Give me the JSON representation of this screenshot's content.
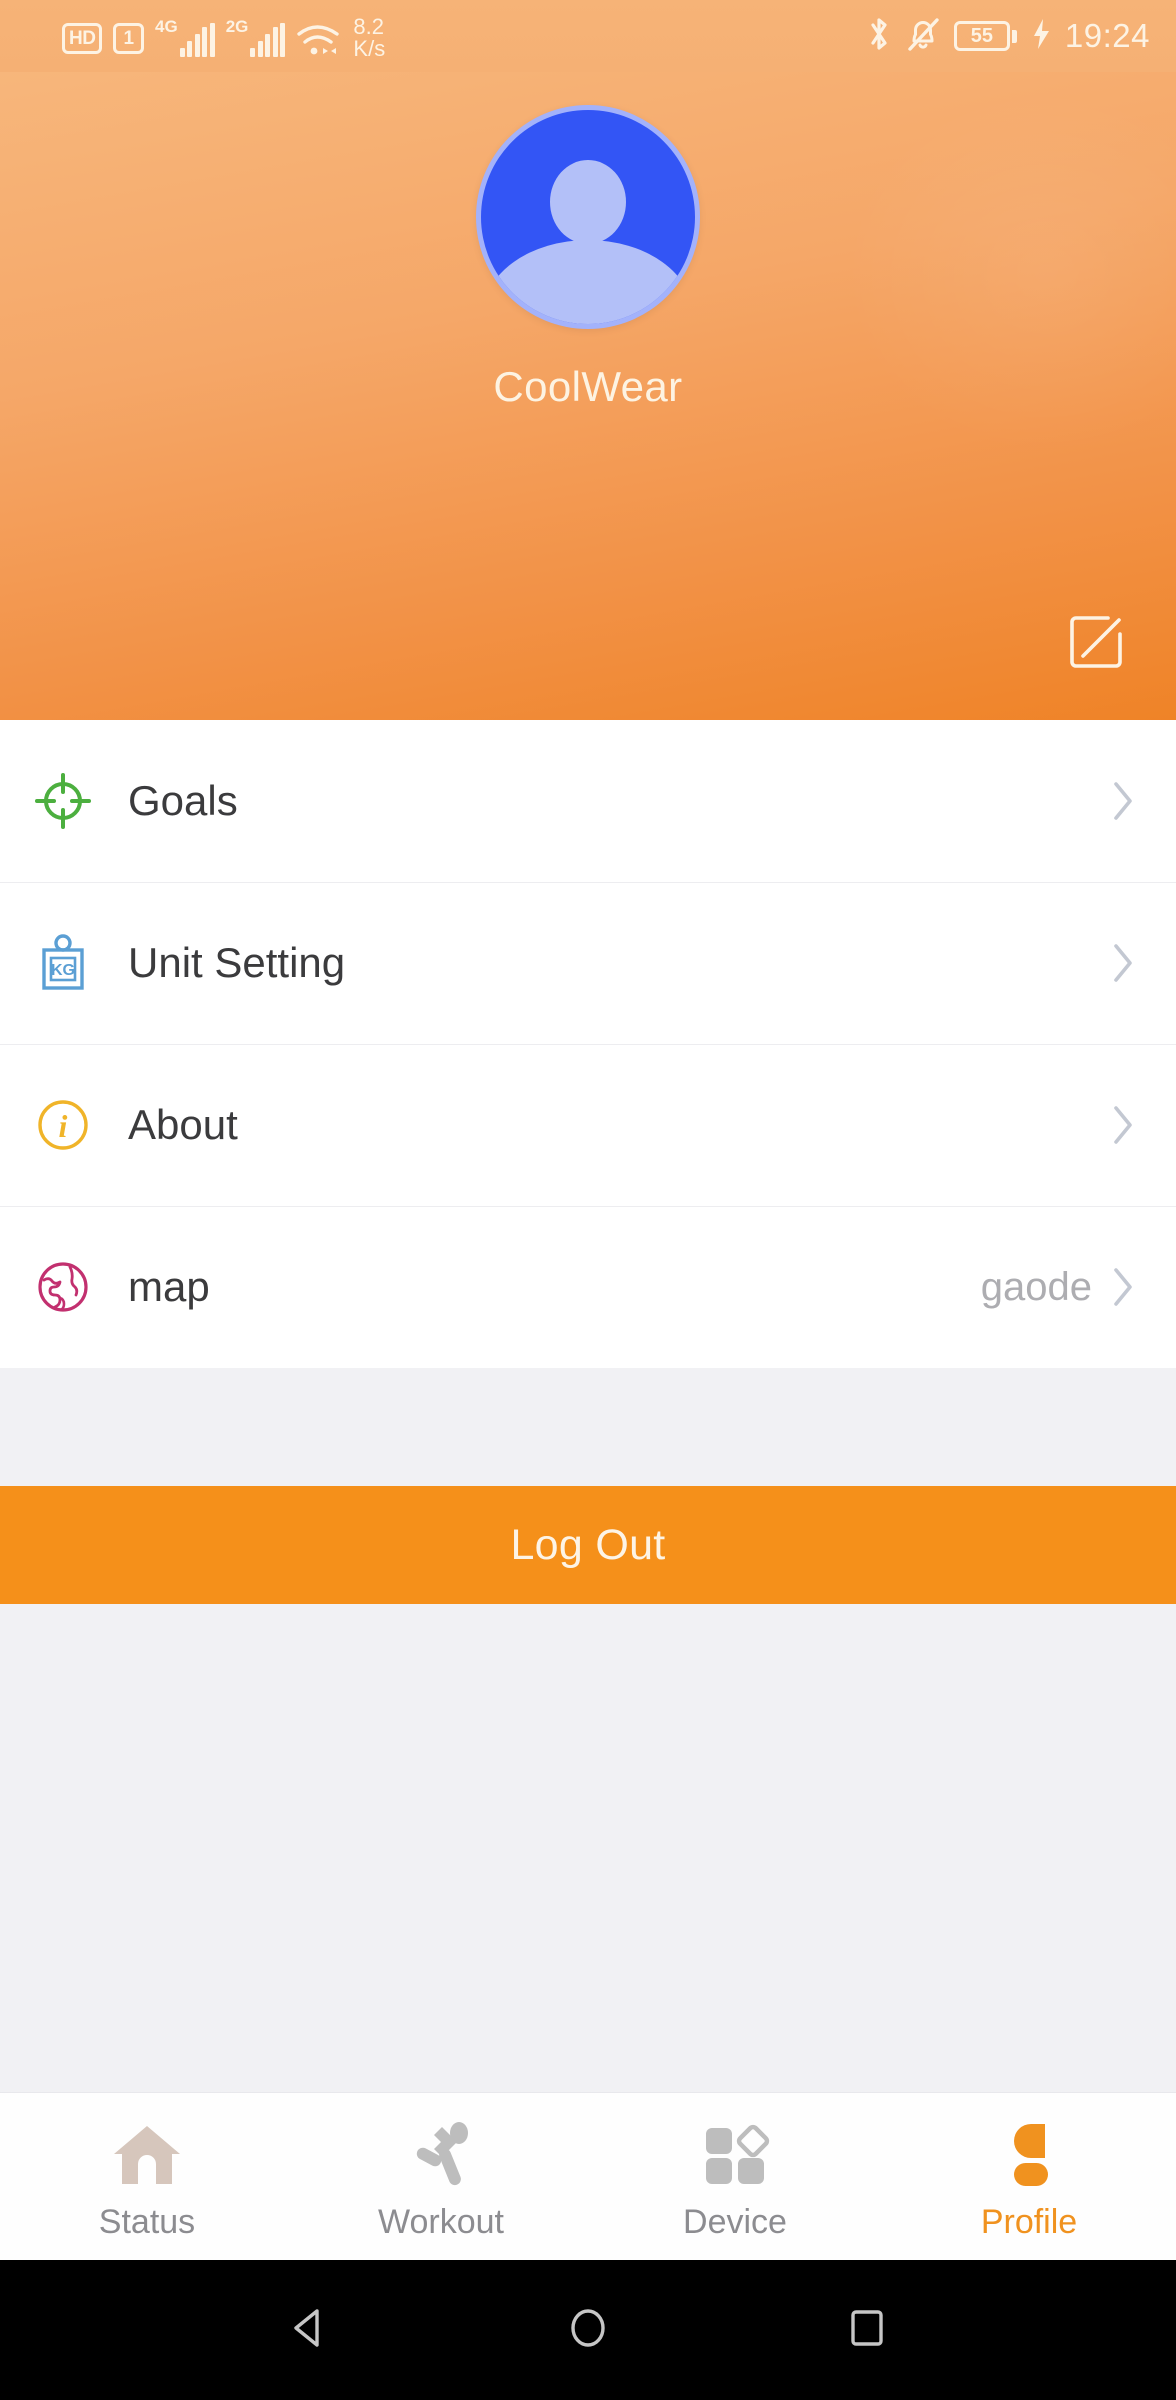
{
  "statusbar": {
    "hd_label": "HD",
    "sim_label": "1",
    "net1_label": "4G",
    "net2_label": "2G",
    "speed_value": "8.2",
    "speed_unit": "K/s",
    "battery_percent": "55",
    "clock": "19:24",
    "icons": [
      "hd-icon",
      "sim-icon",
      "signal-bars-icon",
      "wifi-icon",
      "bluetooth-icon",
      "mute-bell-icon",
      "battery-icon",
      "charging-bolt-icon"
    ]
  },
  "header": {
    "username": "CoolWear",
    "avatar_icon": "person-avatar-icon",
    "edit_icon": "edit-pencil-icon",
    "gradient_from": "#f7b67b",
    "gradient_to": "#ef8327",
    "avatar_color": "#3355f5",
    "avatar_figure_color": "#b3c0f8"
  },
  "list": {
    "rows": [
      {
        "label": "Goals",
        "value": "",
        "icon": "target-crosshair-icon",
        "icon_color": "#4caf3f",
        "chevron": "chevron-right-icon"
      },
      {
        "label": "Unit Setting",
        "value": "",
        "icon": "weight-kg-icon",
        "icon_color": "#5b9fd4",
        "chevron": "chevron-right-icon",
        "icon_text": "KG"
      },
      {
        "label": "About",
        "value": "",
        "icon": "info-circle-icon",
        "icon_color": "#f0b429",
        "chevron": "chevron-right-icon",
        "icon_text": "i"
      },
      {
        "label": "map",
        "value": "gaode",
        "icon": "globe-icon",
        "icon_color": "#c2306f",
        "chevron": "chevron-right-icon"
      }
    ]
  },
  "logout": {
    "label": "Log Out",
    "color": "#f5901a"
  },
  "tabbar": {
    "active_color": "#f0921f",
    "inactive_color": "#8c8c90",
    "tabs": [
      {
        "label": "Status",
        "icon": "home-icon",
        "active": false
      },
      {
        "label": "Workout",
        "icon": "running-icon",
        "active": false
      },
      {
        "label": "Device",
        "icon": "devices-grid-icon",
        "active": false
      },
      {
        "label": "Profile",
        "icon": "person-icon",
        "active": true
      }
    ]
  },
  "navbar": {
    "back_icon": "android-back-icon",
    "home_icon": "android-home-icon",
    "recents_icon": "android-recents-icon"
  }
}
